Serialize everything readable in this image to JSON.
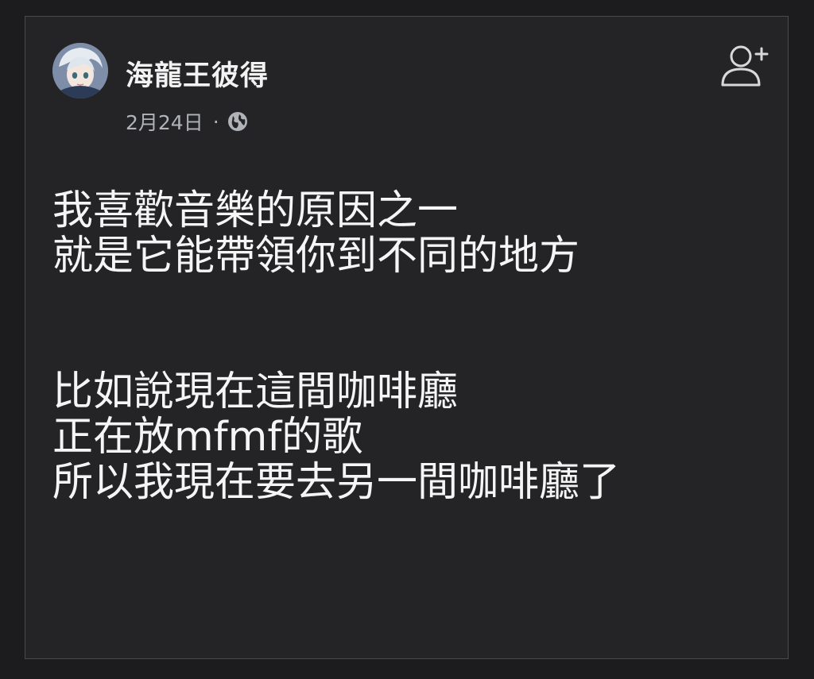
{
  "post": {
    "author": "海龍王彼得",
    "date": "2月24日",
    "separator": "·",
    "privacy_icon": "globe-icon",
    "follow_icon": "add-friend-icon",
    "paragraphs": [
      [
        "我喜歡音樂的原因之一",
        "就是它能帶領你到不同的地方"
      ],
      [
        "比如說現在這間咖啡廳",
        "正在放mfmf的歌",
        "所以我現在要去另一間咖啡廳了"
      ]
    ]
  },
  "colors": {
    "background": "#1c1c1e",
    "card": "#242426",
    "border": "#4a4a4d",
    "text": "#f5f5f5",
    "meta_text": "#b0b3b8"
  }
}
